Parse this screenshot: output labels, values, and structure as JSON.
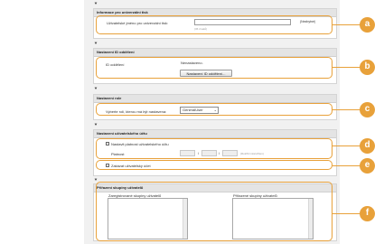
{
  "sections": {
    "universal_print": {
      "title": "Informace pro univerzální tisk",
      "username_label": "Uživatelské jméno pro univerzální tisk:",
      "username_value": "",
      "required_marker": "(Nezbytné)",
      "hint": "(36 znaků)"
    },
    "department": {
      "title": "Nastavení ID oddělení",
      "id_label": "ID oddělení",
      "status": "Nenastaveno.",
      "button": "Nastavení ID oddělení..."
    },
    "role": {
      "title": "Nastavení role",
      "label": "Vyberte roli, kterou má být nastavena:",
      "selected": "GeneralUser"
    },
    "account": {
      "title": "Nastavení uživatelského účtu",
      "validity_checkbox": "Nastavit platnost uživatelského účtu",
      "validity_label": "Platnost",
      "separator": "/",
      "date_hint": "(Rok/M měsíc/Den)",
      "disable_checkbox": "Zakázat uživatelský účet"
    },
    "groups": {
      "title": "Přiřazení skupiny uživatelů",
      "registered_label": "Zaregistrované skupiny uživatelů",
      "assigned_label": "Přiřazené skupiny uživatelů"
    }
  },
  "callouts": [
    "a",
    "b",
    "c",
    "d",
    "e",
    "f"
  ],
  "colors": {
    "callout": "#e8a13a",
    "panel_header": "#e4e4e4",
    "background": "#f1f1f1"
  }
}
